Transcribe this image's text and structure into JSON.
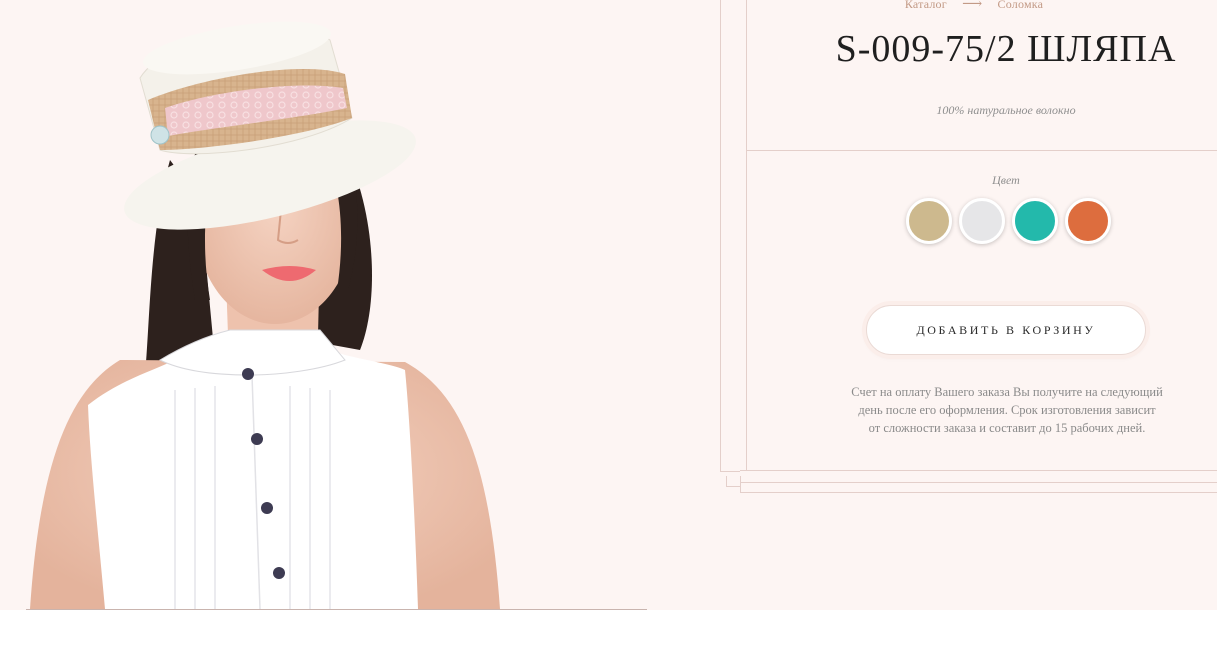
{
  "breadcrumb": {
    "items": [
      {
        "label": "Каталог"
      },
      {
        "label": "Соломка"
      }
    ],
    "separator": "⟶"
  },
  "product": {
    "title": "S-009-75/2 ШЛЯПА",
    "material": "100% натуральное волокно"
  },
  "colors": {
    "label": "Цвет",
    "swatches": [
      {
        "name": "beige",
        "hex": "#cdb98e"
      },
      {
        "name": "light-gray",
        "hex": "#e6e6e8"
      },
      {
        "name": "turquoise",
        "hex": "#23b9ab"
      },
      {
        "name": "orange",
        "hex": "#dd6d3e"
      }
    ]
  },
  "cart": {
    "button_label": "ДОБАВИТЬ В КОРЗИНУ"
  },
  "note": {
    "lines": [
      "Счет на оплату Вашего заказа Вы получите на следующий",
      "день после его оформления. Срок изготовления зависит",
      "от сложности заказа и составит до 15 рабочих дней."
    ]
  },
  "theme": {
    "background": "#fdf5f3",
    "accent": "#c39a86",
    "frame": "#e4cfca"
  }
}
